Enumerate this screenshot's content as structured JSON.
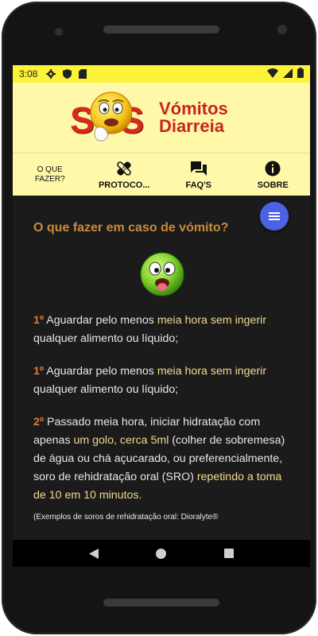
{
  "status_bar": {
    "time": "3:08",
    "icons": [
      "settings-icon",
      "shield-icon",
      "sd-card-icon",
      "wifi-icon",
      "signal-icon",
      "battery-icon"
    ]
  },
  "banner": {
    "logo_sos": "SOS",
    "logo_line1": "Vómitos",
    "logo_line2": "Diarreia"
  },
  "tabs": [
    {
      "label": "O QUE FAZER?",
      "icon": "none"
    },
    {
      "label": "PROTOCO...",
      "icon": "bandage-icon"
    },
    {
      "label": "FAQ'S",
      "icon": "chat-icon"
    },
    {
      "label": "SOBRE",
      "icon": "info-icon"
    }
  ],
  "content": {
    "heading": "O que fazer em caso de vómito?",
    "p1": {
      "num": "1º",
      "text_a": " Aguardar pelo menos ",
      "hl": "meia hora sem ingerir",
      "text_b": " qualquer alimento ou líquido;"
    },
    "p2": {
      "num": "1º",
      "text_a": " Aguardar pelo menos ",
      "hl": "meia hora sem ingerir",
      "text_b": " qualquer alimento ou líquido;"
    },
    "p3": {
      "num": "2º",
      "text_a": " Passado meia hora, iniciar hidratação com apenas ",
      "hl1": "um golo, cerca 5ml",
      "text_b": " (colher de sobremesa) de água ou chá açucarado, ou preferencialmente, soro de rehidratação oral (SRO) ",
      "hl2": "repetindo a toma de 10 em 10 minutos.",
      "small": "(Exemplos de soros de rehidratação oral: Dioralyte®"
    }
  },
  "colors": {
    "status_bar": "#fcf23a",
    "banner_bg": "#fef8a8",
    "content_bg": "#1b1b1b",
    "heading": "#c98a3a",
    "number": "#e07a3c",
    "highlight": "#f2d98e",
    "fab": "#4b63e3"
  }
}
